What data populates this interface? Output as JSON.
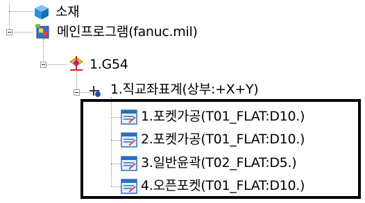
{
  "tree": {
    "nodes": [
      {
        "id": "material",
        "label": "소재",
        "icon": "material-ball-icon"
      },
      {
        "id": "main-program",
        "label": "메인프로그램(fanuc.mil)",
        "icon": "program-icon"
      },
      {
        "id": "g54",
        "label": "1.G54",
        "icon": "workplane-icon"
      },
      {
        "id": "csys",
        "label": "1.직교좌표계(상부:+X+Y)",
        "icon": "coordinate-system-icon"
      }
    ],
    "operations": [
      {
        "label": "1.포켓가공(T01_FLAT:D10.)",
        "icon": "operation-icon"
      },
      {
        "label": "2.포켓가공(T01_FLAT:D10.)",
        "icon": "operation-icon"
      },
      {
        "label": "3.일반윤곽(T02_FLAT:D5.)",
        "icon": "operation-icon"
      },
      {
        "label": "4.오픈포켓(T01_FLAT:D10.)",
        "icon": "operation-icon"
      }
    ]
  },
  "colors": {
    "connector": "#8a8a8a",
    "highlight_border": "#000000",
    "material_blue": "#2f8fd8",
    "operation_blue": "#2a6fc2"
  }
}
